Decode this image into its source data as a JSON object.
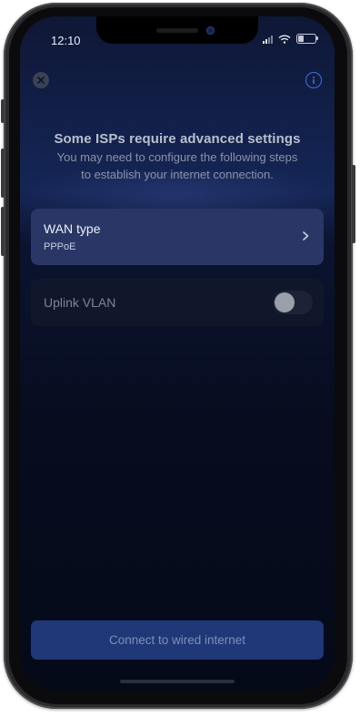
{
  "status_bar": {
    "time": "12:10"
  },
  "header": {
    "close_icon": "close-icon",
    "info_icon": "info-icon"
  },
  "intro": {
    "title": "Some ISPs require advanced settings",
    "subtitle_line1": "You may need to configure the following steps",
    "subtitle_line2": "to establish your internet connection."
  },
  "settings": {
    "wan": {
      "label": "WAN type",
      "value": "PPPoE",
      "icon": "chevron-right-icon"
    },
    "vlan": {
      "label": "Uplink VLAN",
      "enabled": false
    }
  },
  "footer": {
    "connect_label": "Connect to wired internet"
  },
  "colors": {
    "accent": "#3e6fe0",
    "card_active": "#2a3766",
    "button_disabled": "#203778"
  }
}
